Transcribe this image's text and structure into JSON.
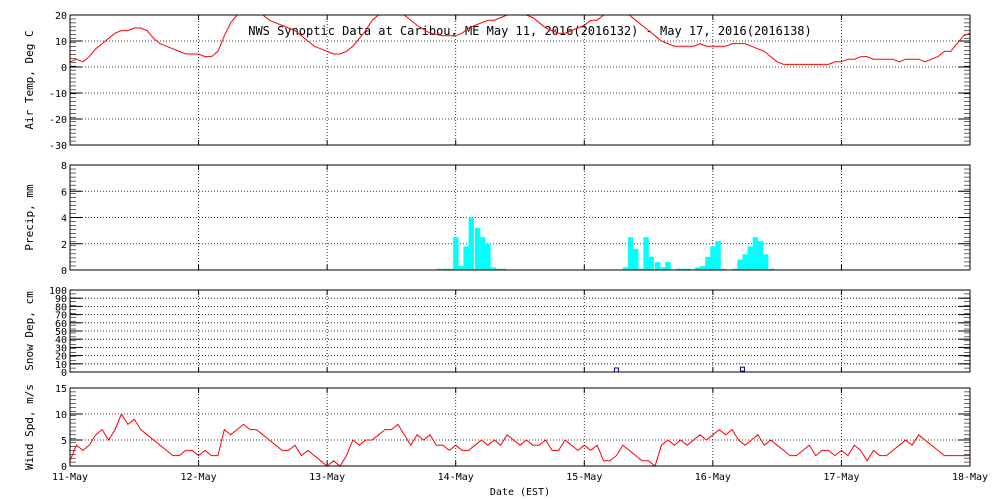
{
  "chart_data": {
    "title": "NWS Synoptic Data at Caribou, ME   May 11, 2016(2016132) - May 17, 2016(2016138)",
    "xlabel": "Date (EST)",
    "x_ticks": [
      "11-May",
      "12-May",
      "13-May",
      "14-May",
      "15-May",
      "16-May",
      "17-May",
      "18-May"
    ],
    "x_range_days": [
      0,
      7
    ],
    "panels": [
      {
        "type": "line",
        "ylabel": "Air Temp, Deg C",
        "ylim": [
          -30,
          20
        ],
        "yticks": [
          -30,
          -20,
          -10,
          0,
          10,
          20
        ],
        "color": "#ff0000",
        "x": [
          0,
          0.05,
          0.1,
          0.15,
          0.2,
          0.25,
          0.3,
          0.35,
          0.4,
          0.45,
          0.5,
          0.55,
          0.6,
          0.65,
          0.7,
          0.75,
          0.8,
          0.85,
          0.9,
          0.95,
          1.0,
          1.05,
          1.1,
          1.15,
          1.2,
          1.25,
          1.3,
          1.35,
          1.4,
          1.45,
          1.5,
          1.55,
          1.6,
          1.65,
          1.7,
          1.75,
          1.8,
          1.85,
          1.9,
          1.95,
          2.0,
          2.05,
          2.1,
          2.15,
          2.2,
          2.25,
          2.3,
          2.35,
          2.4,
          2.45,
          2.5,
          2.6,
          2.7,
          2.8,
          2.9,
          3.0,
          3.05,
          3.1,
          3.15,
          3.2,
          3.25,
          3.3,
          3.35,
          3.4,
          3.45,
          3.5,
          3.55,
          3.6,
          3.65,
          3.7,
          3.75,
          3.8,
          3.85,
          3.9,
          3.95,
          4.0,
          4.05,
          4.1,
          4.15,
          4.2,
          4.25,
          4.3,
          4.35,
          4.4,
          4.45,
          4.5,
          4.55,
          4.6,
          4.65,
          4.7,
          4.75,
          4.8,
          4.85,
          4.9,
          4.95,
          5.0,
          5.05,
          5.1,
          5.15,
          5.2,
          5.25,
          5.3,
          5.35,
          5.4,
          5.45,
          5.5,
          5.55,
          5.6,
          5.65,
          5.7,
          5.75,
          5.8,
          5.85,
          5.9,
          5.95,
          6.0,
          6.05,
          6.1,
          6.15,
          6.2,
          6.25,
          6.3,
          6.35,
          6.4,
          6.45,
          6.5,
          6.55,
          6.6,
          6.65,
          6.7,
          6.75,
          6.8,
          6.85,
          6.9,
          6.95,
          7.0
        ],
        "y": [
          2,
          3,
          2,
          4,
          7,
          9,
          11,
          13,
          14,
          14,
          15,
          15,
          14,
          11,
          9,
          8,
          7,
          6,
          5,
          5,
          5,
          4,
          4,
          6,
          12,
          17,
          22,
          23,
          22,
          21,
          20,
          18,
          17,
          16,
          15,
          14,
          12,
          10,
          8,
          7,
          6,
          5,
          5,
          6,
          8,
          11,
          14,
          18,
          22,
          24,
          23,
          20,
          16,
          13,
          12,
          12,
          13,
          15,
          16,
          17,
          18,
          18,
          19,
          20,
          21,
          22,
          21,
          19,
          17,
          15,
          14,
          13,
          13,
          14,
          15,
          16,
          18,
          18,
          20,
          21,
          23,
          22,
          20,
          18,
          16,
          14,
          12,
          10,
          9,
          8,
          8,
          8,
          8,
          9,
          8,
          8,
          8,
          8,
          9,
          9,
          9,
          8,
          7,
          6,
          4,
          2,
          1,
          1,
          1,
          1,
          1,
          1,
          1,
          1,
          2,
          2,
          3,
          3,
          4,
          4,
          3,
          3,
          3,
          3,
          2,
          3,
          3,
          3,
          2,
          3,
          4,
          6,
          6,
          9,
          12,
          13,
          13,
          12,
          11,
          9,
          7,
          5
        ]
      },
      {
        "type": "bar",
        "ylabel": "Precip, mm",
        "ylim": [
          0,
          8
        ],
        "yticks": [
          0,
          2,
          4,
          6,
          8
        ],
        "color": "#00ffff",
        "bar_width": 0.0417,
        "x": [
          2.85,
          2.9,
          2.94,
          2.98,
          3.02,
          3.06,
          3.1,
          3.15,
          3.19,
          3.23,
          3.27,
          3.31,
          3.35,
          4.3,
          4.34,
          4.38,
          4.42,
          4.46,
          4.5,
          4.55,
          4.59,
          4.63,
          4.71,
          4.75,
          4.79,
          4.86,
          4.9,
          4.94,
          4.98,
          5.02,
          5.06,
          5.15,
          5.19,
          5.23,
          5.27,
          5.31,
          5.35,
          5.39,
          5.44
        ],
        "values": [
          0.1,
          0.1,
          0.1,
          2.5,
          0.3,
          1.8,
          4.0,
          3.2,
          2.5,
          2.0,
          0.2,
          0.1,
          0.1,
          0.2,
          2.5,
          1.6,
          0.1,
          2.5,
          1.0,
          0.6,
          0.2,
          0.6,
          0.1,
          0.1,
          0.1,
          0.2,
          0.3,
          1.0,
          1.8,
          2.2,
          0.1,
          0.1,
          0.8,
          1.2,
          1.8,
          2.5,
          2.2,
          1.2,
          0.1
        ]
      },
      {
        "type": "scatter",
        "ylabel": "Snow Dep, cm",
        "ylim": [
          0,
          100
        ],
        "yticks": [
          0,
          10,
          20,
          30,
          40,
          50,
          60,
          70,
          80,
          90,
          100
        ],
        "color": "#00008b",
        "x": [
          4.25,
          5.23
        ],
        "y": [
          0,
          1
        ]
      },
      {
        "type": "line",
        "ylabel": "Wind Spd, m/s",
        "ylim": [
          0,
          15
        ],
        "yticks": [
          0,
          5,
          10,
          15
        ],
        "color": "#ff0000",
        "x": [
          0,
          0.05,
          0.1,
          0.15,
          0.2,
          0.25,
          0.3,
          0.35,
          0.4,
          0.45,
          0.5,
          0.55,
          0.6,
          0.65,
          0.7,
          0.75,
          0.8,
          0.85,
          0.9,
          0.95,
          1.0,
          1.05,
          1.1,
          1.15,
          1.2,
          1.25,
          1.3,
          1.35,
          1.4,
          1.45,
          1.5,
          1.55,
          1.6,
          1.65,
          1.7,
          1.75,
          1.8,
          1.85,
          1.9,
          1.95,
          2.0,
          2.05,
          2.1,
          2.15,
          2.2,
          2.25,
          2.3,
          2.35,
          2.4,
          2.45,
          2.5,
          2.55,
          2.6,
          2.65,
          2.7,
          2.75,
          2.8,
          2.85,
          2.9,
          2.95,
          3.0,
          3.05,
          3.1,
          3.15,
          3.2,
          3.25,
          3.3,
          3.35,
          3.4,
          3.45,
          3.5,
          3.55,
          3.6,
          3.65,
          3.7,
          3.75,
          3.8,
          3.85,
          3.9,
          3.95,
          4.0,
          4.05,
          4.1,
          4.15,
          4.2,
          4.25,
          4.3,
          4.35,
          4.4,
          4.45,
          4.5,
          4.55,
          4.6,
          4.65,
          4.7,
          4.75,
          4.8,
          4.85,
          4.9,
          4.95,
          5.0,
          5.05,
          5.1,
          5.15,
          5.2,
          5.25,
          5.3,
          5.35,
          5.4,
          5.45,
          5.5,
          5.55,
          5.6,
          5.65,
          5.7,
          5.75,
          5.8,
          5.85,
          5.9,
          5.95,
          6.0,
          6.05,
          6.1,
          6.15,
          6.2,
          6.25,
          6.3,
          6.35,
          6.4,
          6.45,
          6.5,
          6.55,
          6.6,
          6.65,
          6.7,
          6.75,
          6.8,
          6.85,
          6.9,
          6.95,
          7.0
        ],
        "y": [
          1,
          4,
          3,
          4,
          6,
          7,
          5,
          7,
          10,
          8,
          9,
          7,
          6,
          5,
          4,
          3,
          2,
          2,
          3,
          3,
          2,
          3,
          2,
          2,
          7,
          6,
          7,
          8,
          7,
          7,
          6,
          5,
          4,
          3,
          3,
          4,
          2,
          3,
          2,
          1,
          0,
          1,
          0,
          2,
          5,
          4,
          5,
          5,
          6,
          7,
          7,
          8,
          6,
          4,
          6,
          5,
          6,
          4,
          4,
          3,
          4,
          3,
          3,
          4,
          5,
          4,
          5,
          4,
          6,
          5,
          4,
          5,
          4,
          4,
          5,
          3,
          3,
          5,
          4,
          3,
          4,
          3,
          4,
          1,
          1,
          2,
          4,
          3,
          2,
          1,
          1,
          0,
          4,
          5,
          4,
          5,
          4,
          5,
          6,
          5,
          6,
          7,
          6,
          7,
          5,
          4,
          5,
          6,
          4,
          5,
          4,
          3,
          2,
          2,
          3,
          4,
          2,
          3,
          3,
          2,
          3,
          2,
          4,
          3,
          1,
          3,
          2,
          2,
          3,
          4,
          5,
          4,
          6,
          5,
          4,
          3,
          2,
          2,
          2,
          2,
          2
        ]
      }
    ]
  }
}
